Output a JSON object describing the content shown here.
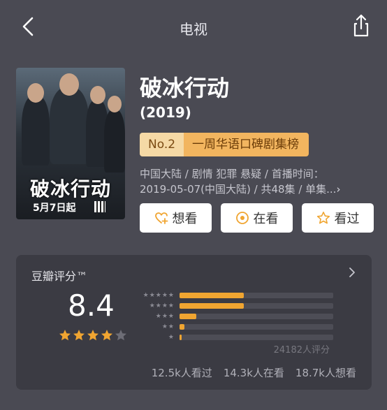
{
  "nav": {
    "title": "电视",
    "back_icon": "chevron-left-icon",
    "share_icon": "share-icon"
  },
  "poster": {
    "logo_text": "破冰行动",
    "date_text": "5月7日起"
  },
  "movie": {
    "title": "破冰行动",
    "year": "(2019)",
    "rank_no": "No.2",
    "rank_name": "一周华语口碑剧集榜",
    "info_line1": "中国大陆 / 剧情 犯罪 悬疑 / 首播时间：",
    "info_line2": "2019-05-07(中国大陆) / 共48集 / 单集..."
  },
  "actions": [
    {
      "label": "想看",
      "icon": "heart-plus-icon"
    },
    {
      "label": "在看",
      "icon": "target-icon"
    },
    {
      "label": "看过",
      "icon": "star-outline-icon"
    }
  ],
  "rating": {
    "title": "豆瓣评分™",
    "score": "8.4",
    "stars_filled": 4,
    "stars_total": 5,
    "distribution": [
      {
        "stars": 5,
        "fraction": 0.42
      },
      {
        "stars": 4,
        "fraction": 0.42
      },
      {
        "stars": 3,
        "fraction": 0.11
      },
      {
        "stars": 2,
        "fraction": 0.03
      },
      {
        "stars": 1,
        "fraction": 0.01
      }
    ],
    "votes": "24182人评分",
    "stats": [
      "12.5k人看过",
      "14.3k人在看",
      "18.7k人想看"
    ]
  },
  "colors": {
    "accent": "#f0a531",
    "background": "#4a4a53",
    "card": "#3b3b43"
  }
}
